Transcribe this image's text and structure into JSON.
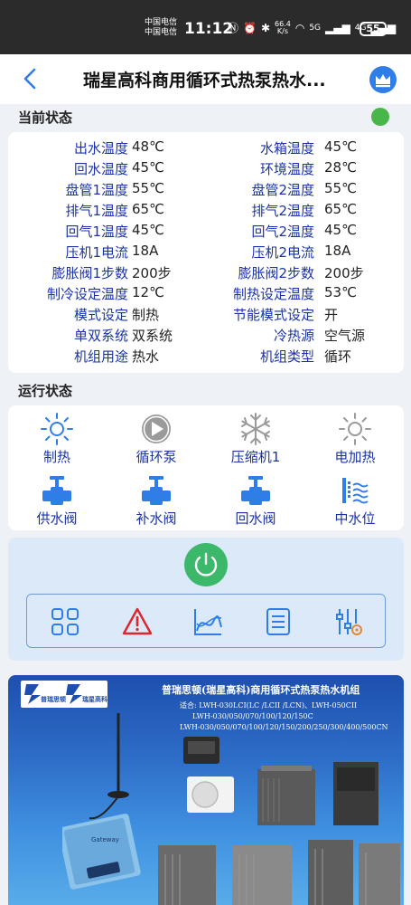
{
  "status_bar": {
    "carrier_1": "中国电信",
    "carrier_2": "中国电信",
    "time": "11:12",
    "speed_value": "66.4",
    "speed_unit": "K/s",
    "net_1": "5G",
    "net_2": "4G",
    "battery": "55"
  },
  "nav": {
    "title": "瑞星高科商用循环式热泵热水..."
  },
  "current_status": {
    "title": "当前状态",
    "rows": [
      {
        "left_label": "出水温度",
        "left_value": "48℃",
        "right_label": "水箱温度",
        "right_value": "45℃"
      },
      {
        "left_label": "回水温度",
        "left_value": "45℃",
        "right_label": "环境温度",
        "right_value": "28℃"
      },
      {
        "left_label": "盘管1温度",
        "left_value": "55℃",
        "right_label": "盘管2温度",
        "right_value": "55℃"
      },
      {
        "left_label": "排气1温度",
        "left_value": "65℃",
        "right_label": "排气2温度",
        "right_value": "65℃"
      },
      {
        "left_label": "回气1温度",
        "left_value": "45℃",
        "right_label": "回气2温度",
        "right_value": "45℃"
      },
      {
        "left_label": "压机1电流",
        "left_value": "18A",
        "right_label": "压机2电流",
        "right_value": "18A"
      },
      {
        "left_label": "膨胀阀1步数",
        "left_value": "200步",
        "right_label": "膨胀阀2步数",
        "right_value": "200步"
      },
      {
        "left_label": "制冷设定温度",
        "left_value": "12℃",
        "right_label": "制热设定温度",
        "right_value": "53℃"
      },
      {
        "left_label": "模式设定",
        "left_value": "制热",
        "right_label": "节能模式设定",
        "right_value": "开"
      },
      {
        "left_label": "单双系统",
        "left_value": "双系统",
        "right_label": "冷热源",
        "right_value": "空气源"
      },
      {
        "left_label": "机组用途",
        "left_value": "热水",
        "right_label": "机组类型",
        "right_value": "循环"
      }
    ]
  },
  "run_status": {
    "title": "运行状态",
    "items": [
      {
        "label": "制热",
        "icon": "sun-icon"
      },
      {
        "label": "循环泵",
        "icon": "pump-play-icon"
      },
      {
        "label": "压缩机1",
        "icon": "snowflake-icon"
      },
      {
        "label": "电加热",
        "icon": "heater-sun-icon"
      },
      {
        "label": "供水阀",
        "icon": "valve-icon"
      },
      {
        "label": "补水阀",
        "icon": "valve-icon"
      },
      {
        "label": "回水阀",
        "icon": "valve-icon"
      },
      {
        "label": "中水位",
        "icon": "water-level-icon"
      }
    ]
  },
  "banner": {
    "title": "普瑞思顿(瑞星高科)商用循环式热泵热水机组",
    "models_line_1": "适合: LWH-030LCI(LC /LCII /LCN)、LWH-050CII",
    "models_line_2": "LWH-030/050/070/100/120/150C",
    "models_line_3": "LWH-030/050/070/100/120/150/200/250/300/400/500CN",
    "brand_1": "普瑞思顿",
    "brand_2": "瑞星高科",
    "device_label": "Gateway"
  },
  "colors": {
    "accent_blue": "#2f7ee8",
    "label_blue": "#1a33a8",
    "online_green": "#49b64a",
    "power_green": "#3cb86a",
    "alarm_red": "#e0242c"
  }
}
